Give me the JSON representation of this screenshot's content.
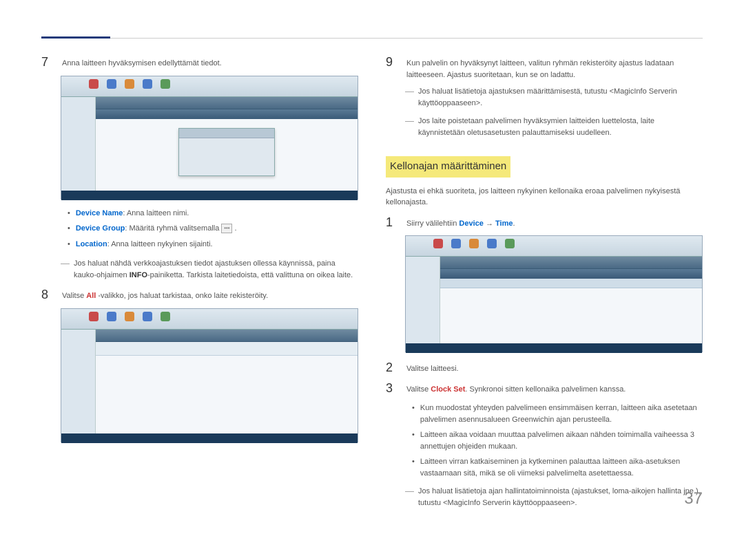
{
  "page_number": "37",
  "left": {
    "step7": {
      "text": "Anna laitteen hyväksymisen edellyttämät tiedot."
    },
    "bullets": {
      "device_name_label": "Device Name",
      "device_name_text": ": Anna laitteen nimi.",
      "device_group_label": "Device Group",
      "device_group_text": ": Määritä ryhmä valitsemalla ",
      "location_label": "Location",
      "location_text": ": Anna laitteen nykyinen sijainti."
    },
    "dash1_pre": "Jos haluat nähdä verkkoajastuksen tiedot ajastuksen ollessa käynnissä, paina kauko-ohjaimen ",
    "dash1_info": "INFO",
    "dash1_post": "-painiketta. Tarkista laitetiedoista, että valittuna on oikea laite.",
    "step8_pre": "Valitse ",
    "step8_all": "All",
    "step8_post": " -valikko, jos haluat tarkistaa, onko laite rekisteröity."
  },
  "right": {
    "step9": {
      "text": "Kun palvelin on hyväksynyt laitteen, valitun ryhmän rekisteröity ajastus ladataan laitteeseen. Ajastus suoritetaan, kun se on ladattu."
    },
    "dash1": "Jos haluat lisätietoja ajastuksen määrittämisestä, tutustu <MagicInfo Serverin käyttöoppaaseen>.",
    "dash2": "Jos laite poistetaan palvelimen hyväksymien laitteiden luettelosta, laite käynnistetään oletusasetusten palauttamiseksi uudelleen.",
    "section_heading": "Kellonajan määrittäminen",
    "intro": "Ajastusta ei ehkä suoriteta, jos laitteen nykyinen kellonaika eroaa palvelimen nykyisestä kellonajasta.",
    "step1_pre": "Siirry välilehtiin ",
    "step1_device": "Device",
    "step1_arrow": " → ",
    "step1_time": "Time",
    "step1_post": ".",
    "step2": "Valitse laitteesi.",
    "step3_pre": "Valitse ",
    "step3_clock": "Clock Set",
    "step3_post": ". Synkronoi sitten kellonaika palvelimen kanssa.",
    "sub1": "Kun muodostat yhteyden palvelimeen ensimmäisen kerran, laitteen aika asetetaan palvelimen asennusalueen Greenwichin ajan perusteella.",
    "sub2": "Laitteen aikaa voidaan muuttaa palvelimen aikaan nähden toimimalla vaiheessa 3 annettujen ohjeiden mukaan.",
    "sub3": "Laitteen virran katkaiseminen ja kytkeminen palauttaa laitteen aika-asetuksen vastaamaan sitä, mikä se oli viimeksi palvelimelta asetettaessa.",
    "dash3": "Jos haluat lisätietoja ajan hallintatoiminnoista (ajastukset, loma-aikojen hallinta jne.), tutustu <MagicInfo Serverin käyttöoppaaseen>."
  }
}
